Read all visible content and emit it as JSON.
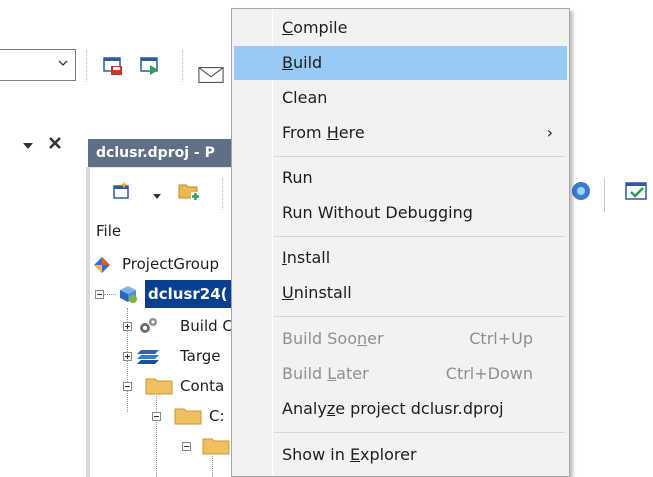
{
  "toolbar": {
    "file_header": "File"
  },
  "panel": {
    "title": "dclusr.dproj - P"
  },
  "tree": {
    "nodes": [
      {
        "label": "ProjectGroup"
      },
      {
        "label": "dclusr24("
      },
      {
        "label": "Build C"
      },
      {
        "label": "Targe"
      },
      {
        "label": "Conta"
      },
      {
        "label": "C:"
      }
    ]
  },
  "menu": {
    "items": [
      {
        "pre": "",
        "ul": "C",
        "post": "ompile",
        "shortcut": "",
        "disabled": false
      },
      {
        "pre": "",
        "ul": "B",
        "post": "uild",
        "shortcut": "",
        "disabled": false,
        "highlighted": true
      },
      {
        "pre": "Clean",
        "ul": "",
        "post": "",
        "shortcut": "",
        "disabled": false
      },
      {
        "pre": "From ",
        "ul": "H",
        "post": "ere",
        "shortcut": "",
        "disabled": false,
        "submenu": true
      },
      {
        "pre": "Run",
        "ul": "",
        "post": "",
        "shortcut": "",
        "disabled": false
      },
      {
        "pre": "Run Without Debugging",
        "ul": "",
        "post": "",
        "shortcut": "",
        "disabled": false
      },
      {
        "pre": "",
        "ul": "I",
        "post": "nstall",
        "shortcut": "",
        "disabled": false
      },
      {
        "pre": "",
        "ul": "U",
        "post": "ninstall",
        "shortcut": "",
        "disabled": false
      },
      {
        "pre": "Build Soo",
        "ul": "n",
        "post": "er",
        "shortcut": "Ctrl+Up",
        "disabled": true
      },
      {
        "pre": "Build ",
        "ul": "L",
        "post": "ater",
        "shortcut": "Ctrl+Down",
        "disabled": true
      },
      {
        "pre": "Analy",
        "ul": "z",
        "post": "e project dclusr.dproj",
        "shortcut": "",
        "disabled": false
      },
      {
        "pre": "Show in ",
        "ul": "E",
        "post": "xplorer",
        "shortcut": "",
        "disabled": false
      }
    ],
    "submenu_arrow": "›"
  },
  "colors": {
    "menu_bg": "#f2f2f2",
    "highlight": "#99c9f5",
    "panel_title_bg": "#5f6f86",
    "selected_node_bg": "#0a3f8f",
    "disabled_text": "#8f8f8f"
  }
}
